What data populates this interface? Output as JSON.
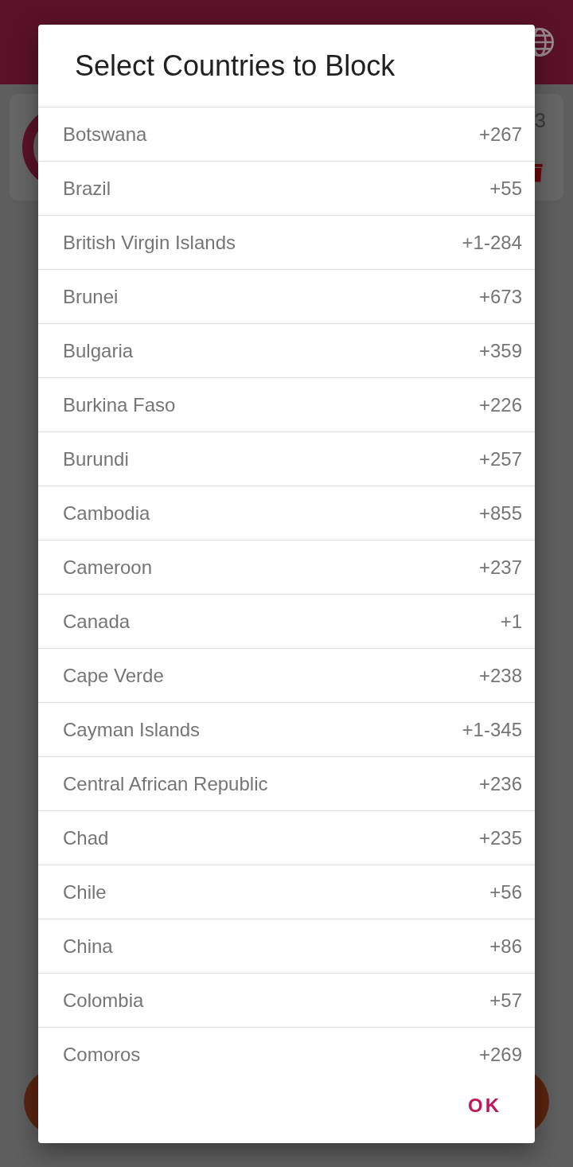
{
  "card": {
    "count": "3"
  },
  "dialog": {
    "title": "Select Countries to Block",
    "countries": [
      {
        "name": "Botswana",
        "code": "+267"
      },
      {
        "name": "Brazil",
        "code": "+55"
      },
      {
        "name": "British Virgin Islands",
        "code": "+1-284"
      },
      {
        "name": "Brunei",
        "code": "+673"
      },
      {
        "name": "Bulgaria",
        "code": "+359"
      },
      {
        "name": "Burkina Faso",
        "code": "+226"
      },
      {
        "name": "Burundi",
        "code": "+257"
      },
      {
        "name": "Cambodia",
        "code": "+855"
      },
      {
        "name": "Cameroon",
        "code": "+237"
      },
      {
        "name": "Canada",
        "code": "+1"
      },
      {
        "name": "Cape Verde",
        "code": "+238"
      },
      {
        "name": "Cayman Islands",
        "code": "+1-345"
      },
      {
        "name": "Central African Republic",
        "code": "+236"
      },
      {
        "name": "Chad",
        "code": "+235"
      },
      {
        "name": "Chile",
        "code": "+56"
      },
      {
        "name": "China",
        "code": "+86"
      },
      {
        "name": "Colombia",
        "code": "+57"
      },
      {
        "name": "Comoros",
        "code": "+269"
      }
    ],
    "ok_button": "OK"
  }
}
